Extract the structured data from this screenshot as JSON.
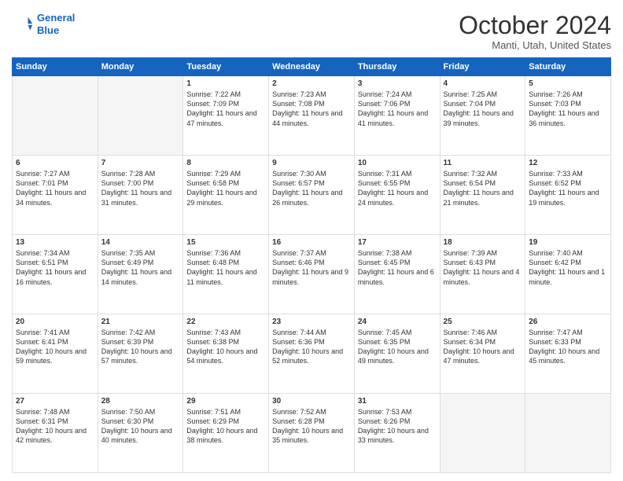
{
  "header": {
    "logo_line1": "General",
    "logo_line2": "Blue",
    "month": "October 2024",
    "location": "Manti, Utah, United States"
  },
  "weekdays": [
    "Sunday",
    "Monday",
    "Tuesday",
    "Wednesday",
    "Thursday",
    "Friday",
    "Saturday"
  ],
  "weeks": [
    [
      {
        "day": "",
        "info": ""
      },
      {
        "day": "",
        "info": ""
      },
      {
        "day": "1",
        "info": "Sunrise: 7:22 AM\nSunset: 7:09 PM\nDaylight: 11 hours and 47 minutes."
      },
      {
        "day": "2",
        "info": "Sunrise: 7:23 AM\nSunset: 7:08 PM\nDaylight: 11 hours and 44 minutes."
      },
      {
        "day": "3",
        "info": "Sunrise: 7:24 AM\nSunset: 7:06 PM\nDaylight: 11 hours and 41 minutes."
      },
      {
        "day": "4",
        "info": "Sunrise: 7:25 AM\nSunset: 7:04 PM\nDaylight: 11 hours and 39 minutes."
      },
      {
        "day": "5",
        "info": "Sunrise: 7:26 AM\nSunset: 7:03 PM\nDaylight: 11 hours and 36 minutes."
      }
    ],
    [
      {
        "day": "6",
        "info": "Sunrise: 7:27 AM\nSunset: 7:01 PM\nDaylight: 11 hours and 34 minutes."
      },
      {
        "day": "7",
        "info": "Sunrise: 7:28 AM\nSunset: 7:00 PM\nDaylight: 11 hours and 31 minutes."
      },
      {
        "day": "8",
        "info": "Sunrise: 7:29 AM\nSunset: 6:58 PM\nDaylight: 11 hours and 29 minutes."
      },
      {
        "day": "9",
        "info": "Sunrise: 7:30 AM\nSunset: 6:57 PM\nDaylight: 11 hours and 26 minutes."
      },
      {
        "day": "10",
        "info": "Sunrise: 7:31 AM\nSunset: 6:55 PM\nDaylight: 11 hours and 24 minutes."
      },
      {
        "day": "11",
        "info": "Sunrise: 7:32 AM\nSunset: 6:54 PM\nDaylight: 11 hours and 21 minutes."
      },
      {
        "day": "12",
        "info": "Sunrise: 7:33 AM\nSunset: 6:52 PM\nDaylight: 11 hours and 19 minutes."
      }
    ],
    [
      {
        "day": "13",
        "info": "Sunrise: 7:34 AM\nSunset: 6:51 PM\nDaylight: 11 hours and 16 minutes."
      },
      {
        "day": "14",
        "info": "Sunrise: 7:35 AM\nSunset: 6:49 PM\nDaylight: 11 hours and 14 minutes."
      },
      {
        "day": "15",
        "info": "Sunrise: 7:36 AM\nSunset: 6:48 PM\nDaylight: 11 hours and 11 minutes."
      },
      {
        "day": "16",
        "info": "Sunrise: 7:37 AM\nSunset: 6:46 PM\nDaylight: 11 hours and 9 minutes."
      },
      {
        "day": "17",
        "info": "Sunrise: 7:38 AM\nSunset: 6:45 PM\nDaylight: 11 hours and 6 minutes."
      },
      {
        "day": "18",
        "info": "Sunrise: 7:39 AM\nSunset: 6:43 PM\nDaylight: 11 hours and 4 minutes."
      },
      {
        "day": "19",
        "info": "Sunrise: 7:40 AM\nSunset: 6:42 PM\nDaylight: 11 hours and 1 minute."
      }
    ],
    [
      {
        "day": "20",
        "info": "Sunrise: 7:41 AM\nSunset: 6:41 PM\nDaylight: 10 hours and 59 minutes."
      },
      {
        "day": "21",
        "info": "Sunrise: 7:42 AM\nSunset: 6:39 PM\nDaylight: 10 hours and 57 minutes."
      },
      {
        "day": "22",
        "info": "Sunrise: 7:43 AM\nSunset: 6:38 PM\nDaylight: 10 hours and 54 minutes."
      },
      {
        "day": "23",
        "info": "Sunrise: 7:44 AM\nSunset: 6:36 PM\nDaylight: 10 hours and 52 minutes."
      },
      {
        "day": "24",
        "info": "Sunrise: 7:45 AM\nSunset: 6:35 PM\nDaylight: 10 hours and 49 minutes."
      },
      {
        "day": "25",
        "info": "Sunrise: 7:46 AM\nSunset: 6:34 PM\nDaylight: 10 hours and 47 minutes."
      },
      {
        "day": "26",
        "info": "Sunrise: 7:47 AM\nSunset: 6:33 PM\nDaylight: 10 hours and 45 minutes."
      }
    ],
    [
      {
        "day": "27",
        "info": "Sunrise: 7:48 AM\nSunset: 6:31 PM\nDaylight: 10 hours and 42 minutes."
      },
      {
        "day": "28",
        "info": "Sunrise: 7:50 AM\nSunset: 6:30 PM\nDaylight: 10 hours and 40 minutes."
      },
      {
        "day": "29",
        "info": "Sunrise: 7:51 AM\nSunset: 6:29 PM\nDaylight: 10 hours and 38 minutes."
      },
      {
        "day": "30",
        "info": "Sunrise: 7:52 AM\nSunset: 6:28 PM\nDaylight: 10 hours and 35 minutes."
      },
      {
        "day": "31",
        "info": "Sunrise: 7:53 AM\nSunset: 6:26 PM\nDaylight: 10 hours and 33 minutes."
      },
      {
        "day": "",
        "info": ""
      },
      {
        "day": "",
        "info": ""
      }
    ]
  ]
}
